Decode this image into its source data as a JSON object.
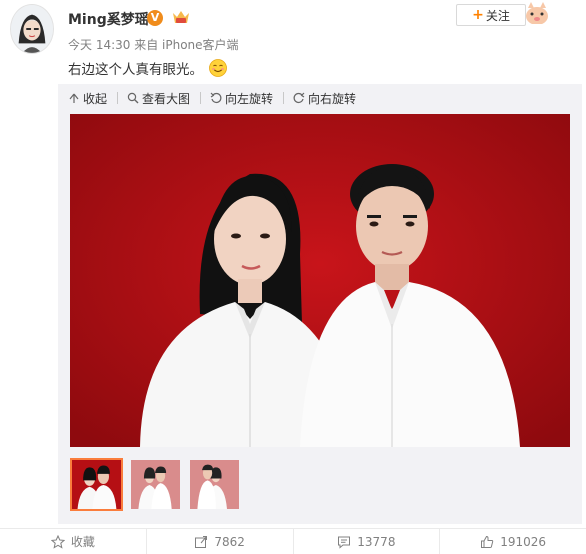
{
  "post": {
    "username": "Ming奚梦瑶",
    "verified_mark": "V",
    "follow_label": "关注",
    "follow_plus": "+",
    "meta": "今天 14:30 来自 iPhone客户端",
    "text": "右边这个人真有眼光。"
  },
  "toolbar": {
    "collapse_label": "收起",
    "view_large_label": "查看大图",
    "rotate_left_label": "向左旋转",
    "rotate_right_label": "向右旋转"
  },
  "thumbnails": {
    "count": 3,
    "selected_index": 0
  },
  "footer": {
    "favorite_label": "收藏",
    "repost_count": "7862",
    "comment_count": "13778",
    "like_count": "191026"
  },
  "colors": {
    "accent": "#ff8200",
    "photo_background": "#b50f14",
    "thumb_background": "#d98c8c",
    "muted_text": "#808080"
  },
  "icons": [
    "avatar",
    "verified-badge-icon",
    "vip-badge-icon",
    "mascot-icon",
    "smiley-emoji-icon",
    "collapse-icon",
    "magnify-icon",
    "rotate-left-icon",
    "rotate-right-icon",
    "star-icon",
    "repost-icon",
    "comment-icon",
    "like-icon"
  ]
}
